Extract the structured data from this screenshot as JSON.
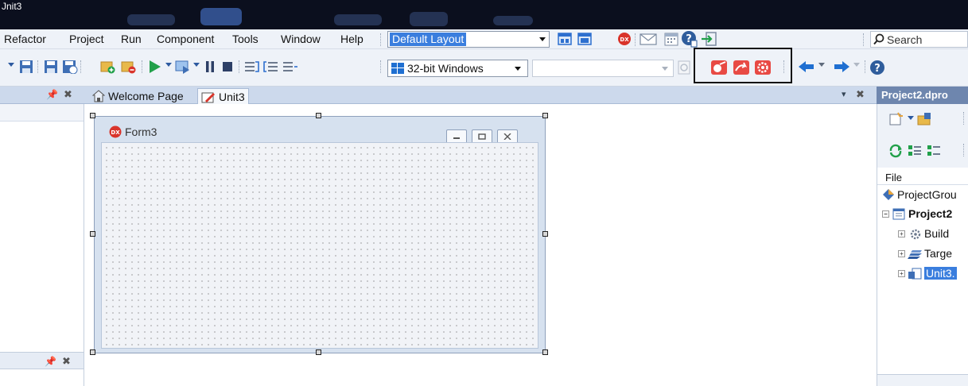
{
  "window": {
    "title": "Jnit3"
  },
  "menu": {
    "items": [
      "Refactor",
      "Project",
      "Run",
      "Component",
      "Tools",
      "Window",
      "Help"
    ],
    "layout_combo": "Default Layout",
    "search_placeholder": "Search"
  },
  "toolbar": {
    "platform": "32-bit Windows",
    "config": ""
  },
  "tabs": {
    "welcome": "Welcome Page",
    "unit": "Unit3"
  },
  "designer": {
    "form_title": "Form3",
    "badge": "DX"
  },
  "project_panel": {
    "title": "Project2.dpro",
    "file_header": "File",
    "nodes": [
      "ProjectGrou",
      "Project2",
      "Build",
      "Targe",
      "Unit3."
    ]
  },
  "colors": {
    "accent": "#3a7ede",
    "dx_red": "#d9342b",
    "run_green": "#21a04a",
    "panel_header": "#6e86ae"
  }
}
